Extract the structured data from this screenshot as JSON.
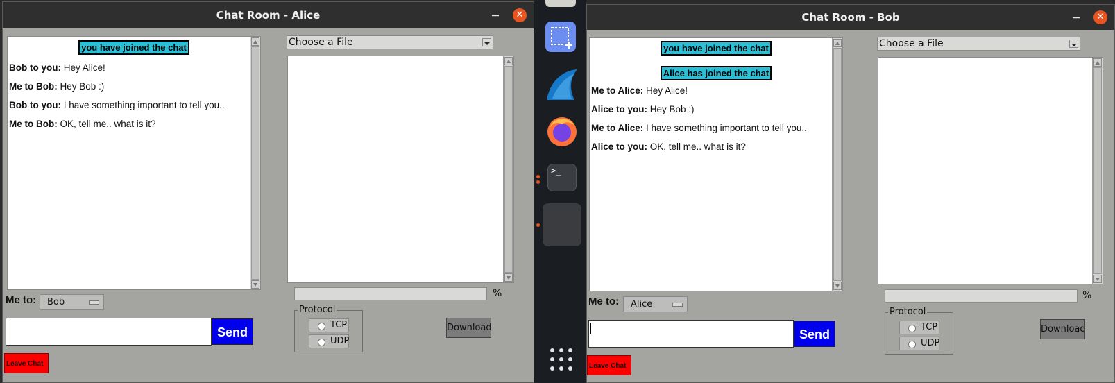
{
  "alice": {
    "title": "Chat Room - Alice",
    "close_glyph": "✕",
    "notices": [
      "you have joined the chat"
    ],
    "messages": [
      {
        "sender": "Bob to you:",
        "text": "Hey Alice!"
      },
      {
        "sender": "Me to Bob:",
        "text": "Hey Bob :)"
      },
      {
        "sender": "Bob to you:",
        "text": "I have something important to tell you.."
      },
      {
        "sender": "Me to Bob:",
        "text": "OK, tell me.. what is it?"
      }
    ],
    "file_select": "Choose a File",
    "progress_unit": "%",
    "protocol_label": "Protocol",
    "tcp_label": "TCP",
    "udp_label": "UDP",
    "download_label": "Download",
    "meto_label": "Me to:",
    "recipient": "Bob",
    "message_value": "",
    "send_label": "Send",
    "leave_label": "Leave Chat"
  },
  "bob": {
    "title": "Chat Room - Bob",
    "close_glyph": "✕",
    "notices": [
      "you have joined the chat",
      "Alice has joined the chat"
    ],
    "messages": [
      {
        "sender": "Me to Alice:",
        "text": "Hey Alice!"
      },
      {
        "sender": "Alice to you:",
        "text": "Hey Bob :)"
      },
      {
        "sender": "Me to Alice:",
        "text": "I have something important to tell you.."
      },
      {
        "sender": "Alice to you:",
        "text": "OK, tell me.. what is it?"
      }
    ],
    "file_select": "Choose a File",
    "progress_unit": "%",
    "protocol_label": "Protocol",
    "tcp_label": "TCP",
    "udp_label": "UDP",
    "download_label": "Download",
    "meto_label": "Me to:",
    "recipient": "Alice",
    "message_value": "",
    "send_label": "Send",
    "leave_label": "Leave Chat"
  },
  "dock": {
    "items": [
      "screenshot-icon",
      "wireshark-icon",
      "firefox-icon",
      "terminal-icon",
      "blank-app-icon",
      "show-apps-icon"
    ],
    "terminal_prompt": ">_"
  },
  "colors": {
    "notice_bg": "#2bbfd6",
    "send_bg": "#0000ee",
    "leave_bg": "#ff0000",
    "close_bg": "#e95420",
    "window_bg": "#a4a4a1"
  }
}
